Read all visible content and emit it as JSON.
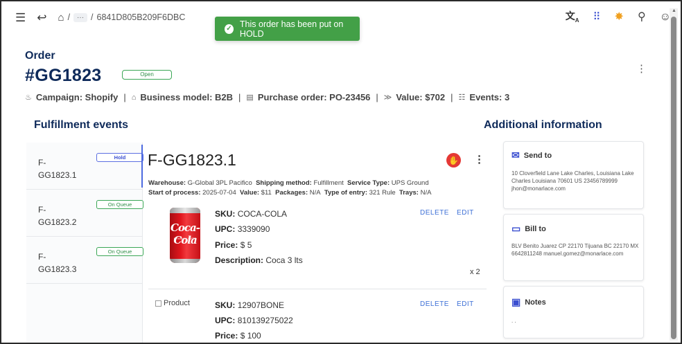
{
  "topbar": {
    "menu_icon": "menu-icon",
    "back_icon": "back-arrow-icon",
    "home_icon": "home-icon",
    "breadcrumb_sep": "/",
    "breadcrumb_ellipsis": "···",
    "breadcrumb_current": "6841D805B209F6DBC",
    "right_icons": [
      "translate-icon",
      "apps-grid-icon",
      "settings-icon",
      "search-icon",
      "account-icon"
    ]
  },
  "toast": {
    "message": "This order has been put on HOLD",
    "color": "#43a047"
  },
  "order": {
    "label": "Order",
    "number": "#GG1823",
    "status": "Open",
    "meta": [
      {
        "icon": "campaign-icon",
        "text": "Campaign: Shopify"
      },
      {
        "icon": "business-icon",
        "text": "Business model: B2B"
      },
      {
        "icon": "document-icon",
        "text": "Purchase order: PO-23456"
      },
      {
        "icon": "value-icon",
        "text": "Value: $702"
      },
      {
        "icon": "events-icon",
        "text": "Events: 3"
      }
    ]
  },
  "sections": {
    "fulfillment_title": "Fulfillment events",
    "additional_title": "Additional information"
  },
  "events": [
    {
      "id_line1": "F-",
      "id_line2": "GG1823.1",
      "badge": "Hold"
    },
    {
      "id_line1": "F-",
      "id_line2": "GG1823.2",
      "badge": "On Queue"
    },
    {
      "id_line1": "F-",
      "id_line2": "GG1823.3",
      "badge": "On Queue"
    }
  ],
  "detail": {
    "title": "F-GG1823.1",
    "warehouse_label": "Warehouse:",
    "warehouse": "G-Global 3PL Pacifico",
    "shipping_label": "Shipping method:",
    "shipping": "Fulfillment",
    "service_label": "Service Type:",
    "service": "UPS Ground",
    "start_label": "Start of process:",
    "start": "2025-07-04",
    "value_label": "Value:",
    "value": "$11",
    "packages_label": "Packages:",
    "packages": "N/A",
    "entry_label": "Type of entry:",
    "entry": "321 Rule",
    "trays_label": "Trays:",
    "trays": "N/A"
  },
  "products": [
    {
      "sku_label": "SKU:",
      "sku": "COCA-COLA",
      "upc_label": "UPC:",
      "upc": "3339090",
      "price_label": "Price:",
      "price": "$ 5",
      "desc_label": "Description:",
      "desc": "Coca 3 lts",
      "qty": "x 2",
      "image_text": "Coca-Cola",
      "delete": "DELETE",
      "edit": "EDIT"
    },
    {
      "sku_label": "SKU:",
      "sku": "12907BONE",
      "upc_label": "UPC:",
      "upc": "810139275022",
      "price_label": "Price:",
      "price": "$ 100",
      "image_alt": "Product",
      "delete": "DELETE",
      "edit": "EDIT"
    }
  ],
  "cards": {
    "send_to": {
      "title": "Send to",
      "icon": "mail-icon",
      "text": "10 Cloverfield Lane Lake Charles, Louisiana Lake Charles Louisiana 70601 US 23456789999 jhon@monarlace.com"
    },
    "bill_to": {
      "title": "Bill to",
      "icon": "credit-card-icon",
      "text": "BLV Benito Juarez CP 22170 Tijuana BC 22170 MX 6642811248 manuel.gomez@monarlace.com"
    },
    "notes": {
      "title": "Notes",
      "icon": "notes-icon",
      "text": ". ."
    }
  },
  "colors": {
    "brand": "#0e2a5a",
    "accent": "#3d6fd6",
    "success": "#43a047",
    "danger": "#e53935"
  }
}
